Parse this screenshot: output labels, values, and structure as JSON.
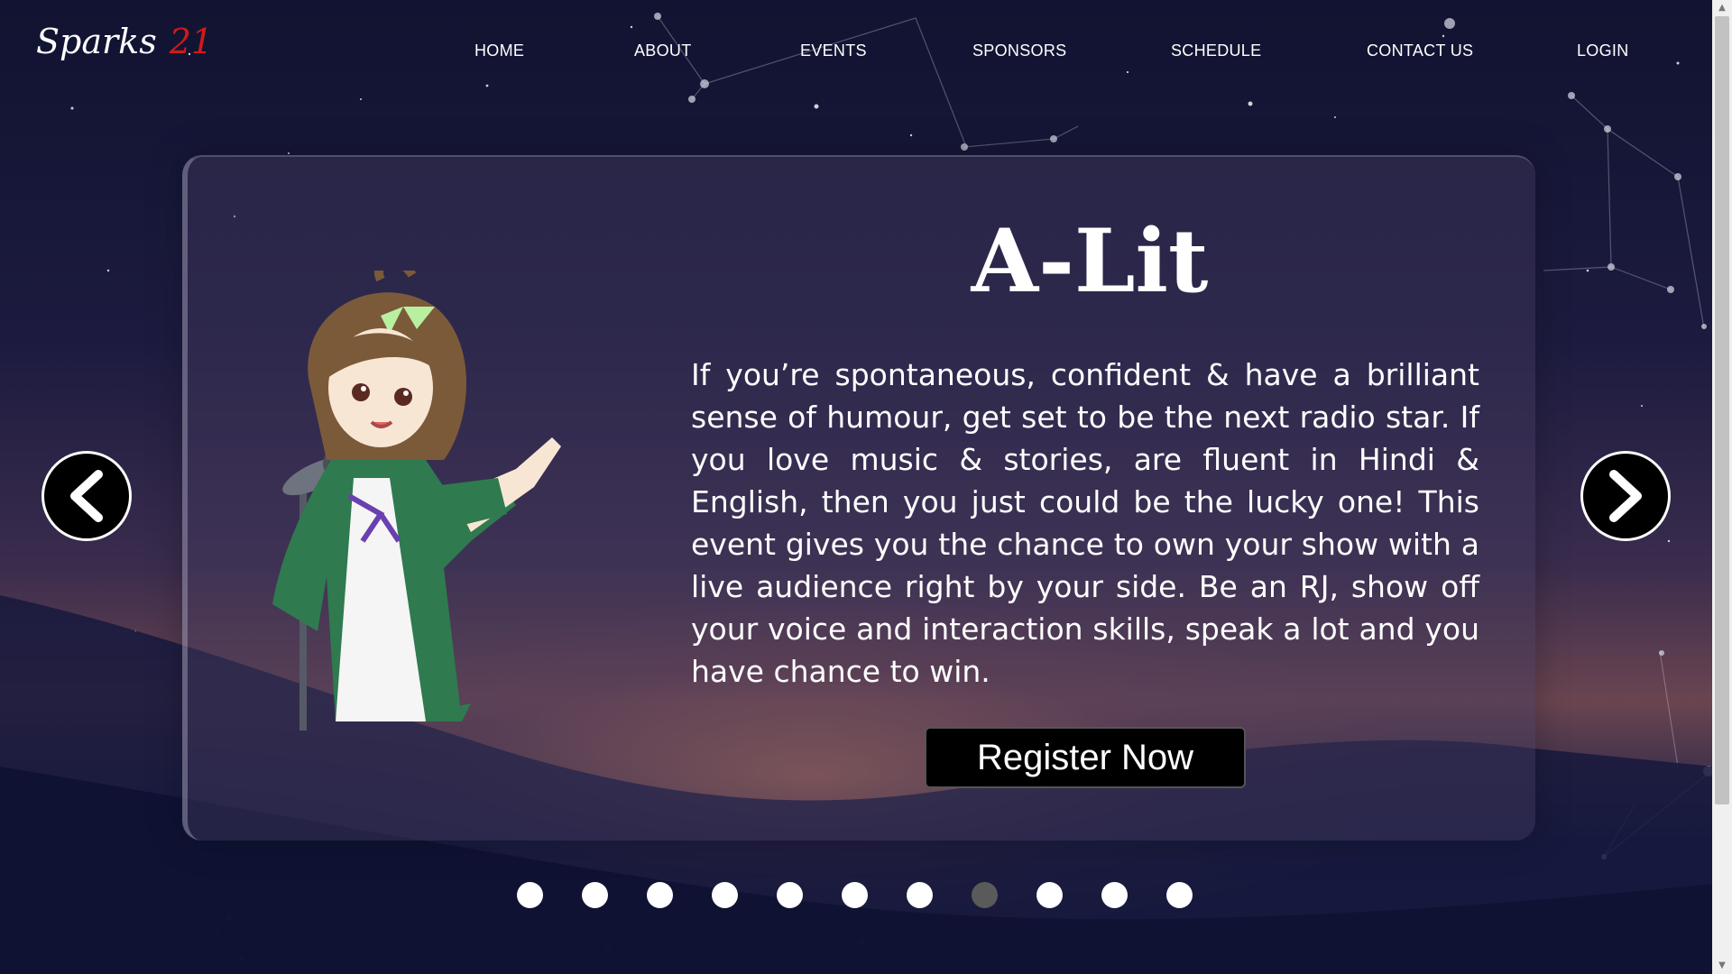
{
  "logo": {
    "brand": "Sparks",
    "year": "21"
  },
  "nav": {
    "items": [
      "HOME",
      "ABOUT",
      "EVENTS",
      "SPONSORS",
      "SCHEDULE",
      "CONTACT US",
      "LOGIN"
    ]
  },
  "slide": {
    "title": "A-Lit",
    "description": "If you’re spontaneous, confident & have a brilliant sense of humour, get set to be the next radio star. If you love music & stories, are fluent in Hindi & English, then you just could be the lucky one! This event gives you the chance to own your show with a live audience right by your side. Be an RJ, show off your voice and interaction skills, speak a lot and you have chance to win.",
    "register_label": "Register Now",
    "illustration": "anime-girl-microphone"
  },
  "carousel": {
    "prev_icon": "chevron-left-icon",
    "next_icon": "chevron-right-icon",
    "dot_count": 11,
    "active_dot": 8
  },
  "colors": {
    "accent_red": "#d11a1a",
    "button_bg": "#000000",
    "dot_active": "#5a5a5a",
    "dot_inactive": "#ffffff"
  }
}
